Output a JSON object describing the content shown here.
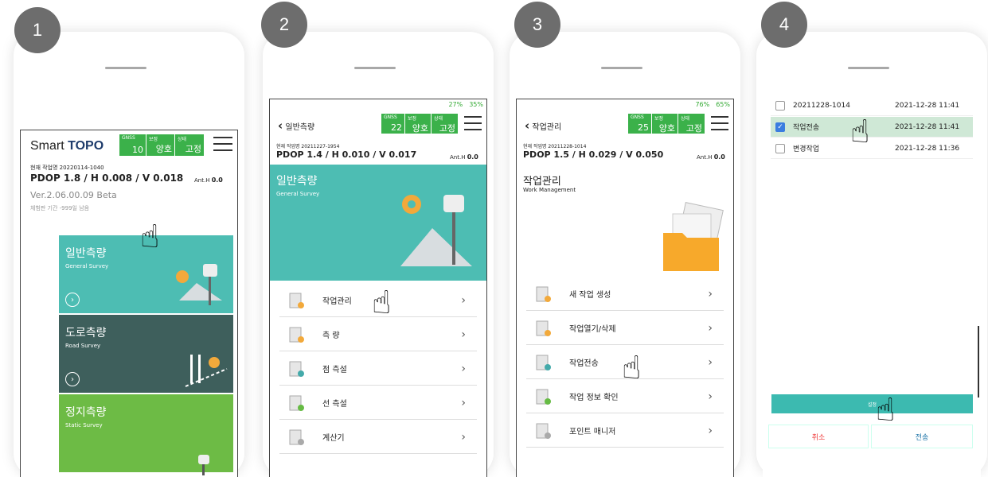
{
  "p1": {
    "badge": "1",
    "logo1": "Smart ",
    "logo2": "TOPO",
    "gnss": {
      "l1": "GNSS",
      "v1": "10",
      "l2": "보정",
      "v2": "양호",
      "l3": "상태",
      "v3": "고정"
    },
    "job": "현재 작업명 20220114-1040",
    "pdop": "PDOP 1.8 / H 0.008 / V 0.018",
    "anth": "Ant.H",
    "anthv": "0.0",
    "ver": "Ver.2.06.00.09 Beta",
    "trial": "체험판 기간 -999일 남음",
    "cards": [
      {
        "t": "일반측량",
        "s": "General Survey",
        "color": "#4dbdb3"
      },
      {
        "t": "도로측량",
        "s": "Road Survey",
        "color": "#3e5f5c"
      },
      {
        "t": "정지측량",
        "s": "Static Survey",
        "color": "#6dbb45"
      }
    ]
  },
  "p2": {
    "badge": "2",
    "bat1": "27%",
    "bat2": "35%",
    "back": "일반측량",
    "gnss": {
      "l1": "GNSS",
      "v1": "22",
      "l2": "보정",
      "v2": "양호",
      "l3": "상태",
      "v3": "고정"
    },
    "job": "현재 작업명 20211227-1954",
    "pdop": "PDOP 1.4 / H 0.010 / V 0.017",
    "anth": "Ant.H",
    "anthv": "0.0",
    "hero_t": "일반측량",
    "hero_s": "General Survey",
    "items": [
      "작업관리",
      "측 량",
      "점 측설",
      "선 측설",
      "계산기"
    ]
  },
  "p3": {
    "badge": "3",
    "bat1": "76%",
    "bat2": "65%",
    "back": "작업관리",
    "gnss": {
      "l1": "GNSS",
      "v1": "25",
      "l2": "보정",
      "v2": "양호",
      "l3": "상태",
      "v3": "고정"
    },
    "job": "현재 작업명 20211228-1014",
    "pdop": "PDOP 1.5 / H 0.029 / V 0.050",
    "anth": "Ant.H",
    "anthv": "0.0",
    "title": "작업관리",
    "sub": "Work Management",
    "items": [
      "새 작업 생성",
      "작업열기/삭제",
      "작업전송",
      "작업 정보 확인",
      "포인트 매니저"
    ]
  },
  "p4": {
    "badge": "4",
    "rows": [
      {
        "name": "20211228-1014",
        "date": "2021-12-28 11:41",
        "checked": false
      },
      {
        "name": "작업전송",
        "date": "2021-12-28 11:41",
        "checked": true
      },
      {
        "name": "변경작업",
        "date": "2021-12-28 11:36",
        "checked": false
      }
    ],
    "setting": "설정",
    "cancel": "취소",
    "send": "전송"
  }
}
